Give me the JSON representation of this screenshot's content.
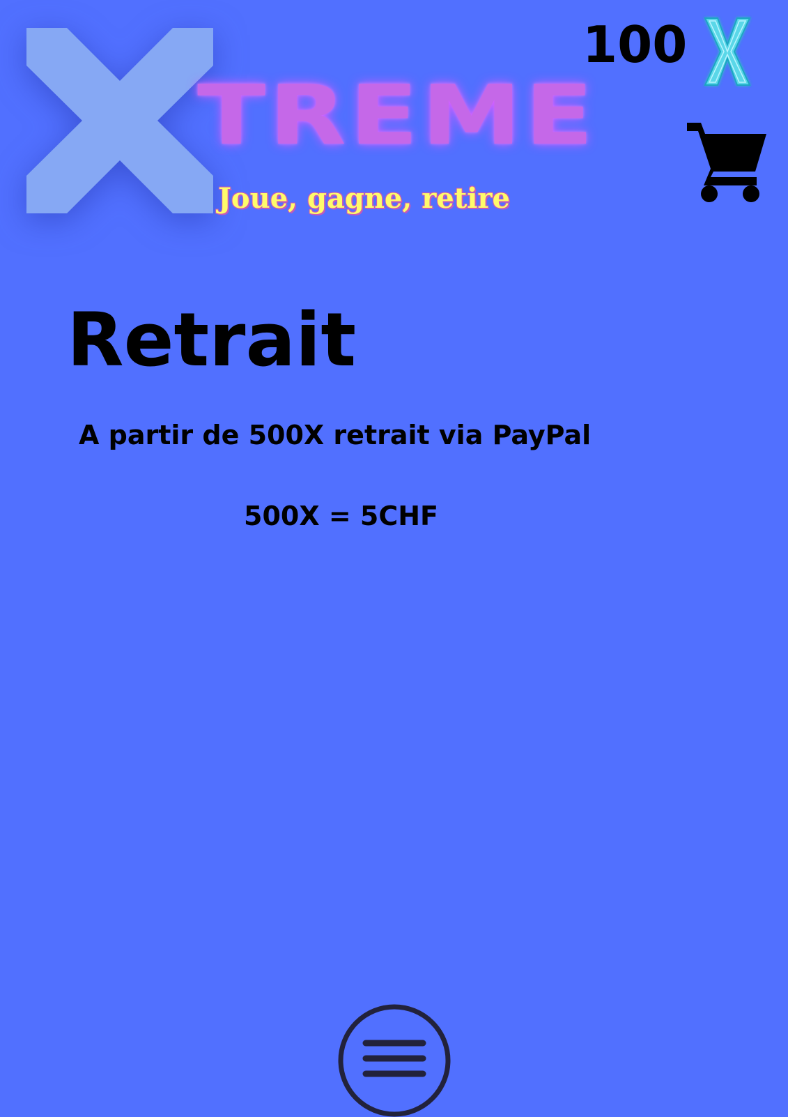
{
  "header": {
    "logo": {
      "letter": "X",
      "wordmark": "TREME",
      "tagline": "Joue, gagne, retire"
    },
    "balance": "100",
    "currency_icon": "x-coin-icon",
    "cart_icon": "shopping-cart-icon"
  },
  "main": {
    "title": "Retrait",
    "withdraw_info": "A partir de 500X retrait via PayPal",
    "exchange_rate": "500X = 5CHF"
  },
  "footer": {
    "menu_icon": "hamburger-menu-icon"
  },
  "colors": {
    "background": "#5170ff",
    "logo_x": "#86a8f4",
    "logo_wordmark": "#c568e8",
    "tagline": "#fffb6b",
    "coin_icon": "#3fd3e6",
    "text": "#000000"
  }
}
